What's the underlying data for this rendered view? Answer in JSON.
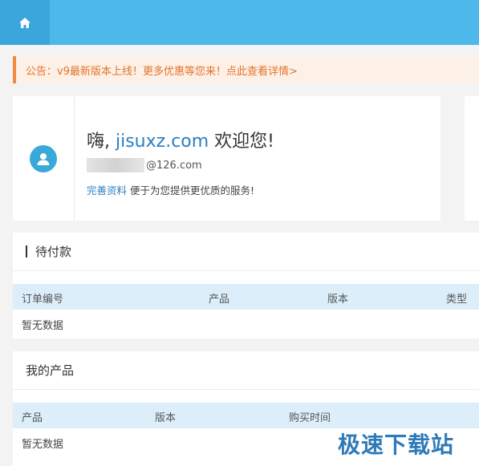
{
  "topbar": {
    "home_icon": "home-icon",
    "accent": "#4db8ea"
  },
  "notice": {
    "text": "公告：v9最新版本上线！更多优惠等您来！",
    "link": "点此查看详情>"
  },
  "welcome": {
    "greeting_prefix": "嗨, ",
    "site": "jisuxz.com",
    "greeting_suffix": " 欢迎您!",
    "email_suffix": "@126.com",
    "profile_link": "完善资料",
    "profile_text": " 便于为您提供更优质的服务!"
  },
  "pending": {
    "title": "待付款",
    "columns": [
      "订单编号",
      "产品",
      "版本",
      "类型"
    ],
    "empty": "暂无数据"
  },
  "products": {
    "title": "我的产品",
    "columns": [
      "产品",
      "版本",
      "购买时间"
    ],
    "empty": "暂无数据"
  },
  "watermark": "极速下载站"
}
